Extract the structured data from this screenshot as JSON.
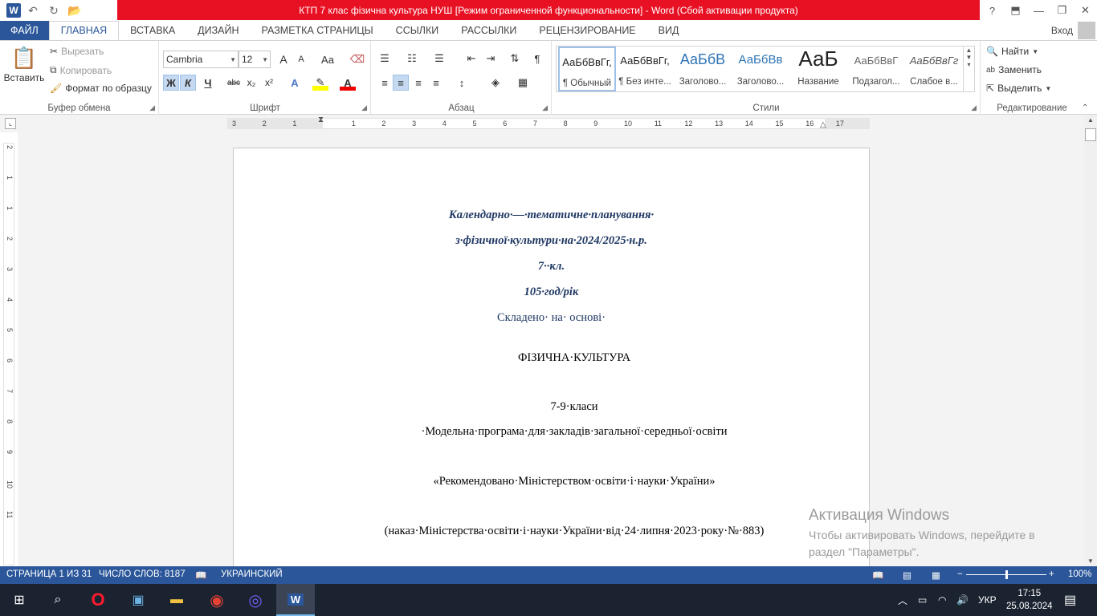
{
  "titlebar": {
    "title": "КТП 7 клас фізична культура НУШ [Режим ограниченной функциональности] -  Word (Сбой активации продукта)",
    "help": "?",
    "ribbon_display": "⬒",
    "minimize": "—",
    "restore": "❐",
    "close": "✕",
    "accent_color": "#e81123"
  },
  "qat": {
    "app_icon": "W",
    "undo": "↶",
    "redo": "↻",
    "open": "📂"
  },
  "tabs": [
    "ФАЙЛ",
    "ГЛАВНАЯ",
    "ВСТАВКА",
    "ДИЗАЙН",
    "РАЗМЕТКА СТРАНИЦЫ",
    "ССЫЛКИ",
    "РАССЫЛКИ",
    "РЕЦЕНЗИРОВАНИЕ",
    "ВИД"
  ],
  "active_tab": "ГЛАВНАЯ",
  "signin": "Вход",
  "clipboard": {
    "paste": "Вставить",
    "cut": "Вырезать",
    "copy": "Копировать",
    "format_painter": "Формат по образцу",
    "label": "Буфер обмена"
  },
  "font": {
    "name": "Cambria",
    "size": "12",
    "bold": "Ж",
    "italic": "К",
    "underline": "Ч",
    "strike": "abc",
    "subscript": "x₂",
    "superscript": "x²",
    "grow": "A",
    "shrink": "A",
    "case": "Aa",
    "label": "Шрифт"
  },
  "paragraph": {
    "pilcrow": "¶",
    "label": "Абзац"
  },
  "styles": {
    "items": [
      {
        "preview": "АаБбВвГг,",
        "name": "¶ Обычный"
      },
      {
        "preview": "АаБбВвГг,",
        "name": "¶ Без инте..."
      },
      {
        "preview": "АаБбВ",
        "name": "Заголово..."
      },
      {
        "preview": "АаБбВв",
        "name": "Заголово..."
      },
      {
        "preview": "АаБ",
        "name": "Название"
      },
      {
        "preview": "АаБбВвГ",
        "name": "Подзагол..."
      },
      {
        "preview": "АаБбВвГг",
        "name": "Слабое в..."
      }
    ],
    "label": "Стили"
  },
  "editing": {
    "find": "Найти",
    "replace": "Заменить",
    "select": "Выделить",
    "label": "Редактирование"
  },
  "ruler": {
    "h_numbers": [
      "3",
      "2",
      "1",
      "1",
      "2",
      "3",
      "4",
      "5",
      "6",
      "7",
      "8",
      "9",
      "10",
      "11",
      "12",
      "13",
      "14",
      "15",
      "16",
      "17"
    ],
    "v_numbers": [
      "2",
      "1",
      "1",
      "2",
      "3",
      "4",
      "5",
      "6",
      "7",
      "8",
      "9",
      "10",
      "11"
    ]
  },
  "document": {
    "lines": [
      "Календарно·—·тематичне·планування·",
      "з·фізичної·культури·на·2024/2025·н.р.",
      "7··кл.",
      "105·год/рік",
      "Складено· на· основі·",
      "ФІЗИЧНА·КУЛЬТУРА",
      "7-9·класи",
      "·Модельна·програма·для·закладів·загальної·середньої·освіти",
      "«Рекомендовано·Міністерством·освіти·і·науки·України»",
      "(наказ·Міністерства·освіти·і·науки·України·від·24·липня·2023·року·№·883)"
    ],
    "title_color": "#1f3864"
  },
  "watermark": {
    "title": "Активация Windows",
    "line1": "Чтобы активировать Windows, перейдите в",
    "line2": "раздел \"Параметры\"."
  },
  "status": {
    "page": "СТРАНИЦА 1 ИЗ 31",
    "words": "ЧИСЛО СЛОВ: 8187",
    "language": "УКРАИНСКИЙ",
    "zoom": "100%",
    "zoom_fraction": 0.5,
    "bar_color": "#2b579a"
  },
  "taskbar": {
    "apps": [
      "windows-start",
      "search",
      "opera",
      "control-panel",
      "file-explorer",
      "chrome",
      "viber",
      "word"
    ],
    "lang": "УКР",
    "time": "17:15",
    "date": "25.08.2024"
  }
}
